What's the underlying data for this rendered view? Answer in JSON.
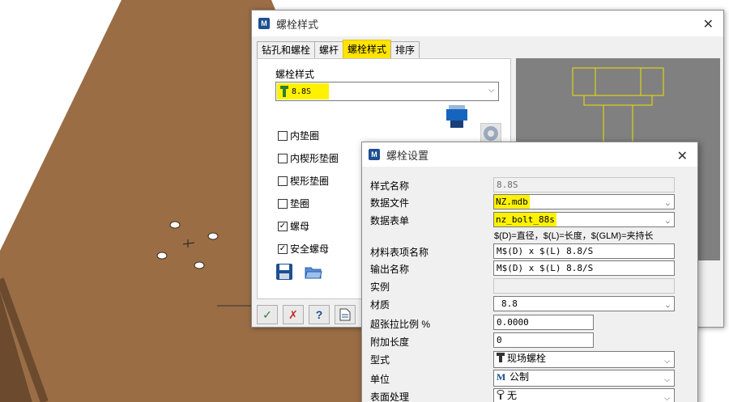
{
  "window_main": {
    "title": "螺栓样式",
    "tabs": [
      "钻孔和螺栓",
      "螺杆",
      "螺栓样式",
      "排序"
    ],
    "style_label": "螺栓样式",
    "style_value": "8.8S",
    "checkboxes": [
      {
        "label": "内垫圈",
        "checked": false
      },
      {
        "label": "内楔形垫圈",
        "checked": false
      },
      {
        "label": "楔形垫圈",
        "checked": false
      },
      {
        "label": "垫圈",
        "checked": false
      },
      {
        "label": "螺母",
        "checked": true
      },
      {
        "label": "安全螺母",
        "checked": true
      }
    ],
    "check_mark": "✓",
    "buttons": {
      "ok_glyph": "✓",
      "cancel_glyph": "✗",
      "help_glyph": "?"
    }
  },
  "window_settings": {
    "title": "螺栓设置",
    "close_glyph": "✕",
    "rows": [
      {
        "label": "样式名称",
        "value": "8.8S"
      },
      {
        "label": "数据文件",
        "value": "NZ.mdb"
      },
      {
        "label": "数据表单",
        "value": "nz_bolt_88s"
      },
      {
        "label": "材料表项名称",
        "value": "M$(D) x $(L) 8.8/S"
      },
      {
        "label": "输出名称",
        "value": "M$(D) x $(L) 8.8/S"
      },
      {
        "label": "实例",
        "value": ""
      },
      {
        "label": "材质",
        "value": "8.8"
      },
      {
        "label": "超张拉比例 %",
        "value": "0.0000"
      },
      {
        "label": "附加长度",
        "value": "0"
      },
      {
        "label": "型式",
        "value": "现场螺栓"
      },
      {
        "label": "单位",
        "value": "公制"
      },
      {
        "label": "表面处理",
        "value": "无"
      }
    ],
    "hint": "$(D)=直径，$(L)=长度，$(GLM)=夹持长",
    "unit_icon": "M",
    "close_icon": "✕"
  },
  "colors": {
    "highlight": "#fff200",
    "plate_top": "#9a6d45",
    "plate_side": "#6b4a2e",
    "preview_bg": "#808080",
    "preview_line": "#f0e000"
  }
}
